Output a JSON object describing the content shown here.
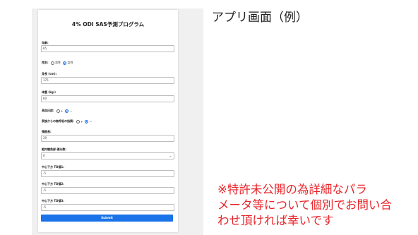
{
  "panel_title": "アプリ画面（例）",
  "form": {
    "title": "4% ODI SAS予測プログラム",
    "age": {
      "label": "年齢:",
      "value": "65"
    },
    "sex": {
      "label": "性別:",
      "options": [
        "男性",
        "女性"
      ],
      "selected": "女性"
    },
    "height": {
      "label": "身長 (cm):",
      "value": "175"
    },
    "weight": {
      "label": "体重 (kg):",
      "value": "60"
    },
    "hypertension": {
      "label": "高血圧症:",
      "options": [
        "+",
        "−"
      ],
      "selected": "−"
    },
    "breathing": {
      "label": "家族からの無呼吸の指摘:",
      "options": [
        "+",
        "−"
      ],
      "selected": "−"
    },
    "neck": {
      "label": "頸囲長:",
      "value": "29"
    },
    "field_a": {
      "label": "縦内顎角部 硬分数:",
      "value": "0"
    },
    "field_b": {
      "label": "中心下方 TD値1:",
      "value": "-5"
    },
    "field_c": {
      "label": "中心下方 TD値2:",
      "value": "-5"
    },
    "field_d": {
      "label": "中心下方 TD値3:",
      "value": "-5"
    },
    "submit_label": "Submit"
  },
  "note_lines": [
    "※特許未公開の為詳細なパラ",
    "メータ等について個別でお問い合",
    "わせ頂ければ幸いです"
  ],
  "colors": {
    "accent": "#1a73e8",
    "note": "#e8242a"
  }
}
